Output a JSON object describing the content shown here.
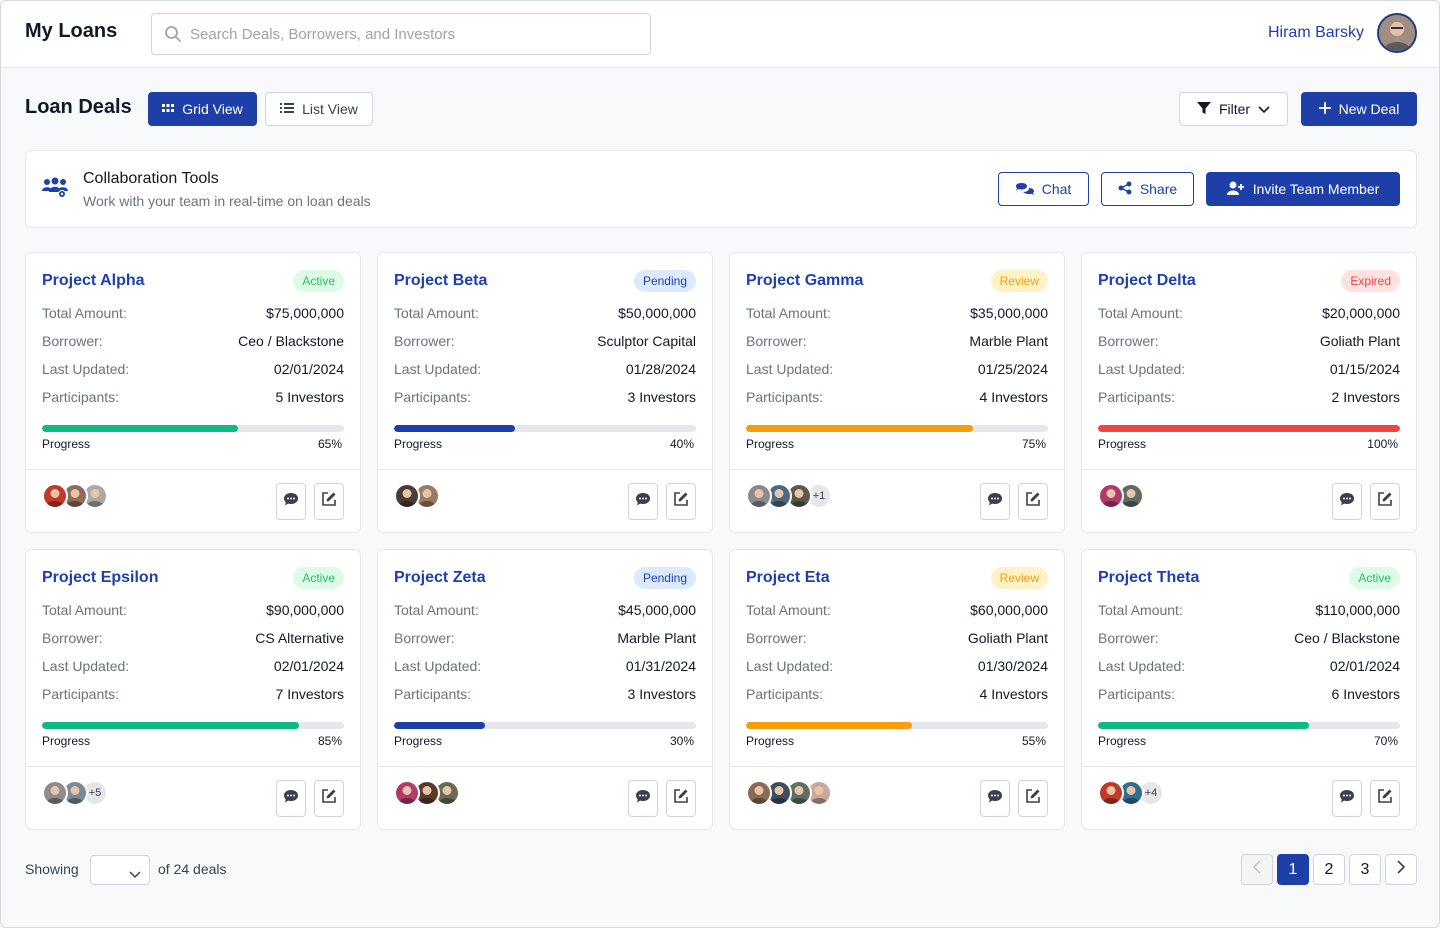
{
  "app": {
    "title": "My Loans"
  },
  "search": {
    "placeholder": "Search Deals, Borrowers, and Investors"
  },
  "user": {
    "name": "Hiram Barsky"
  },
  "header": {
    "title": "Loan Deals",
    "grid_view": "Grid View",
    "list_view": "List View",
    "filter": "Filter",
    "new_deal": "New Deal"
  },
  "collab": {
    "title": "Collaboration Tools",
    "subtitle": "Work with your team in real-time on loan deals",
    "chat": "Chat",
    "share": "Share",
    "invite": "Invite Team Member"
  },
  "labels": {
    "total_amount": "Total Amount:",
    "borrower": "Borrower:",
    "last_updated": "Last Updated:",
    "participants": "Participants:",
    "progress": "Progress"
  },
  "status_colors": {
    "active": "#22c55e",
    "pending": "#1e40af",
    "review": "#f59e0b",
    "expired": "#ef4444"
  },
  "deals": [
    {
      "name": "Project Alpha",
      "status": "Active",
      "amount": "$75,000,000",
      "borrower": "Ceo / Blackstone",
      "updated": "02/01/2024",
      "participants": "5 Investors",
      "progress": 65,
      "progress_label": "65%",
      "bar_color": "#10b981",
      "avatars": [
        "#c0392b",
        "#8e6b5a",
        "#a9a9a9"
      ],
      "more": ""
    },
    {
      "name": "Project Beta",
      "status": "Pending",
      "amount": "$50,000,000",
      "borrower": "Sculptor Capital",
      "updated": "01/28/2024",
      "participants": "3 Investors",
      "progress": 40,
      "progress_label": "40%",
      "bar_color": "#1e3fa8",
      "avatars": [
        "#4a3b33",
        "#9c7b63"
      ],
      "more": ""
    },
    {
      "name": "Project Gamma",
      "status": "Review",
      "amount": "$35,000,000",
      "borrower": "Marble Plant",
      "updated": "01/25/2024",
      "participants": "4 Investors",
      "progress": 75,
      "progress_label": "75%",
      "bar_color": "#f59e0b",
      "avatars": [
        "#8a8a8a",
        "#4b6a7f",
        "#5a5a4a"
      ],
      "more": "+1"
    },
    {
      "name": "Project Delta",
      "status": "Expired",
      "amount": "$20,000,000",
      "borrower": "Goliath Plant",
      "updated": "01/15/2024",
      "participants": "2 Investors",
      "progress": 100,
      "progress_label": "100%",
      "bar_color": "#ef4444",
      "avatars": [
        "#b03a6a",
        "#5f6b63"
      ],
      "more": ""
    },
    {
      "name": "Project Epsilon",
      "status": "Active",
      "amount": "$90,000,000",
      "borrower": "CS Alternative",
      "updated": "02/01/2024",
      "participants": "7 Investors",
      "progress": 85,
      "progress_label": "85%",
      "bar_color": "#10b981",
      "avatars": [
        "#8d8d8d",
        "#7a8a99"
      ],
      "more": "+5"
    },
    {
      "name": "Project Zeta",
      "status": "Pending",
      "amount": "$45,000,000",
      "borrower": "Marble Plant",
      "updated": "01/31/2024",
      "participants": "3 Investors",
      "progress": 30,
      "progress_label": "30%",
      "bar_color": "#1e3fa8",
      "avatars": [
        "#b03a6a",
        "#5a3a2a",
        "#6b6b55"
      ],
      "more": ""
    },
    {
      "name": "Project Eta",
      "status": "Review",
      "amount": "$60,000,000",
      "borrower": "Goliath Plant",
      "updated": "01/30/2024",
      "participants": "4 Investors",
      "progress": 55,
      "progress_label": "55%",
      "bar_color": "#f59e0b",
      "avatars": [
        "#8a6a55",
        "#3e4e5e",
        "#5f6f63",
        "#c9a89a"
      ],
      "more": ""
    },
    {
      "name": "Project Theta",
      "status": "Active",
      "amount": "$110,000,000",
      "borrower": "Ceo / Blackstone",
      "updated": "02/01/2024",
      "participants": "6 Investors",
      "progress": 70,
      "progress_label": "70%",
      "bar_color": "#10b981",
      "avatars": [
        "#c0392b",
        "#2f6f8f"
      ],
      "more": "+4"
    }
  ],
  "pagination": {
    "showing": "Showing",
    "of_deals": "of 24 deals",
    "pages": [
      "1",
      "2",
      "3"
    ],
    "current": "1"
  }
}
